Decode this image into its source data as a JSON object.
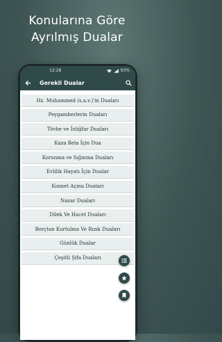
{
  "promo": {
    "headline_line1": "Konularına Göre",
    "headline_line2": "Ayrılmış Dualar"
  },
  "status_bar": {
    "time": "12:28",
    "battery": "93%"
  },
  "app_bar": {
    "title": "Gerekli Dualar"
  },
  "list_items": [
    "Hz. Muhammed (s.a.v.)'in Duaları",
    "Peygamberlerin Duaları",
    "Tövbe ve İstiğfar Duaları",
    "Kaza Bela İçin Dua",
    "Korunma ve Sığınma Duaları",
    "Evlilik Hayatı İçin Dualar",
    "Kısmet Açma Duaları",
    "Nazar Duaları",
    "Dilek Ve Hacet Duaları",
    "Borçtan Kurtulma Ve Rızık Duaları",
    "Günlük Dualar",
    "Çeşitli Şifa Duaları"
  ],
  "fabs": [
    "list-icon",
    "star-icon",
    "bookmark-icon"
  ],
  "colors": {
    "primary": "#2f4a49",
    "row_bg": "#e9efee",
    "background": "#3f5654"
  }
}
